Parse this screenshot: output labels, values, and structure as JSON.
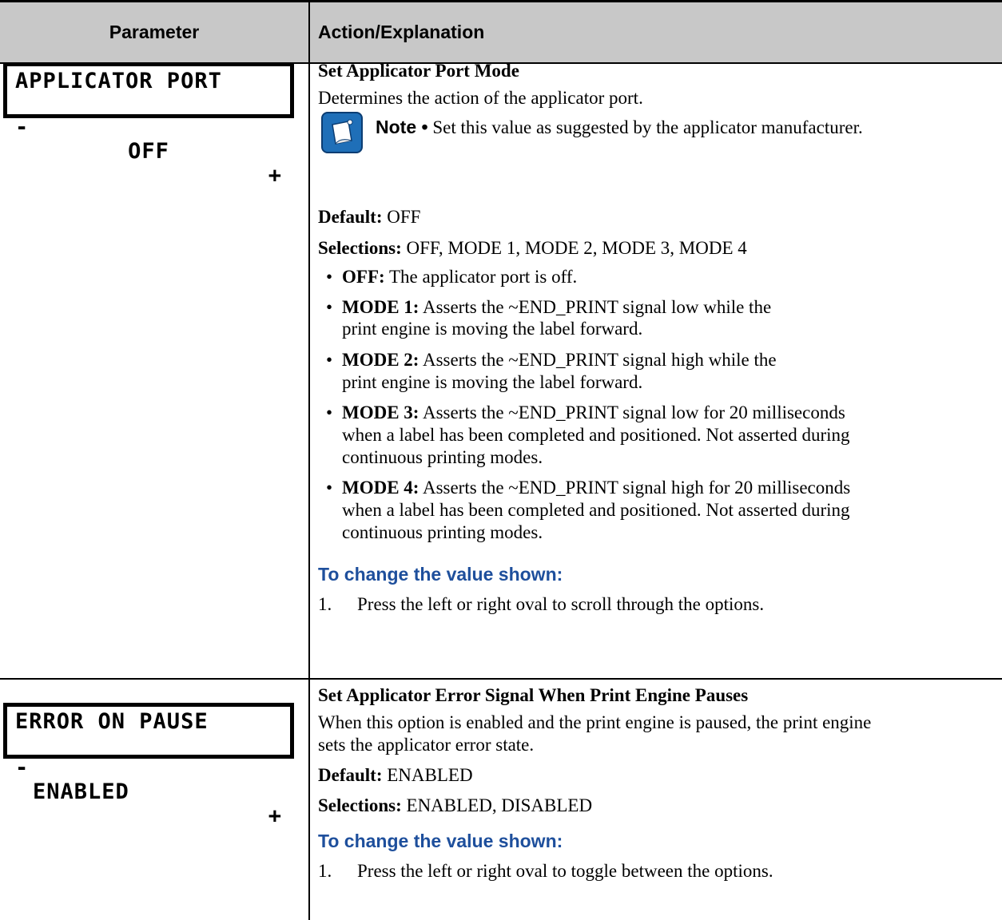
{
  "header": {
    "parameter": "Parameter",
    "action": "Action/Explanation"
  },
  "rows": [
    {
      "lcd": {
        "line1": "APPLICATOR PORT",
        "minus": "-",
        "value": "OFF",
        "plus": "+"
      },
      "title": "Set Applicator Port Mode",
      "description": "Determines the action of the applicator port.",
      "note": {
        "label": "Note •",
        "text": "Set this value as suggested by the applicator manufacturer.",
        "icon": "note-icon"
      },
      "default_label": "Default:",
      "default_value": "OFF",
      "selections_label": "Selections:",
      "selections_value": "OFF, MODE 1, MODE 2, MODE 3, MODE 4",
      "bullets": [
        {
          "label": "OFF:",
          "lines": [
            "The applicator port is off."
          ]
        },
        {
          "label": "MODE 1:",
          "lines": [
            "Asserts the ~END_PRINT signal low while the",
            "print engine is moving the label forward."
          ]
        },
        {
          "label": "MODE 2:",
          "lines": [
            "Asserts the ~END_PRINT signal high while the",
            "print engine is moving the label forward."
          ]
        },
        {
          "label": "MODE 3:",
          "lines": [
            "Asserts the ~END_PRINT signal low for 20 milliseconds",
            "when a label has been completed and positioned. Not asserted during",
            "continuous printing modes."
          ]
        },
        {
          "label": "MODE 4:",
          "lines": [
            "Asserts the ~END_PRINT signal high for 20 milliseconds",
            "when a label has been completed and positioned. Not asserted during",
            "continuous printing modes."
          ]
        }
      ],
      "change_heading": "To change the value shown:",
      "step_number": "1.",
      "step_text": "Press the left or right oval to scroll through the options."
    },
    {
      "lcd": {
        "line1": "ERROR ON PAUSE",
        "minus": "-",
        "value": "ENABLED",
        "plus": "+"
      },
      "title": "Set Applicator Error Signal When Print Engine Pauses",
      "description_lines": [
        "When this option is enabled and the print engine is paused, the print engine",
        "sets the applicator error state."
      ],
      "default_label": "Default:",
      "default_value": "ENABLED",
      "selections_label": "Selections:",
      "selections_value": "ENABLED, DISABLED",
      "change_heading": "To change the value shown:",
      "step_number": "1.",
      "step_text": "Press the left or right oval to toggle between the options."
    }
  ]
}
